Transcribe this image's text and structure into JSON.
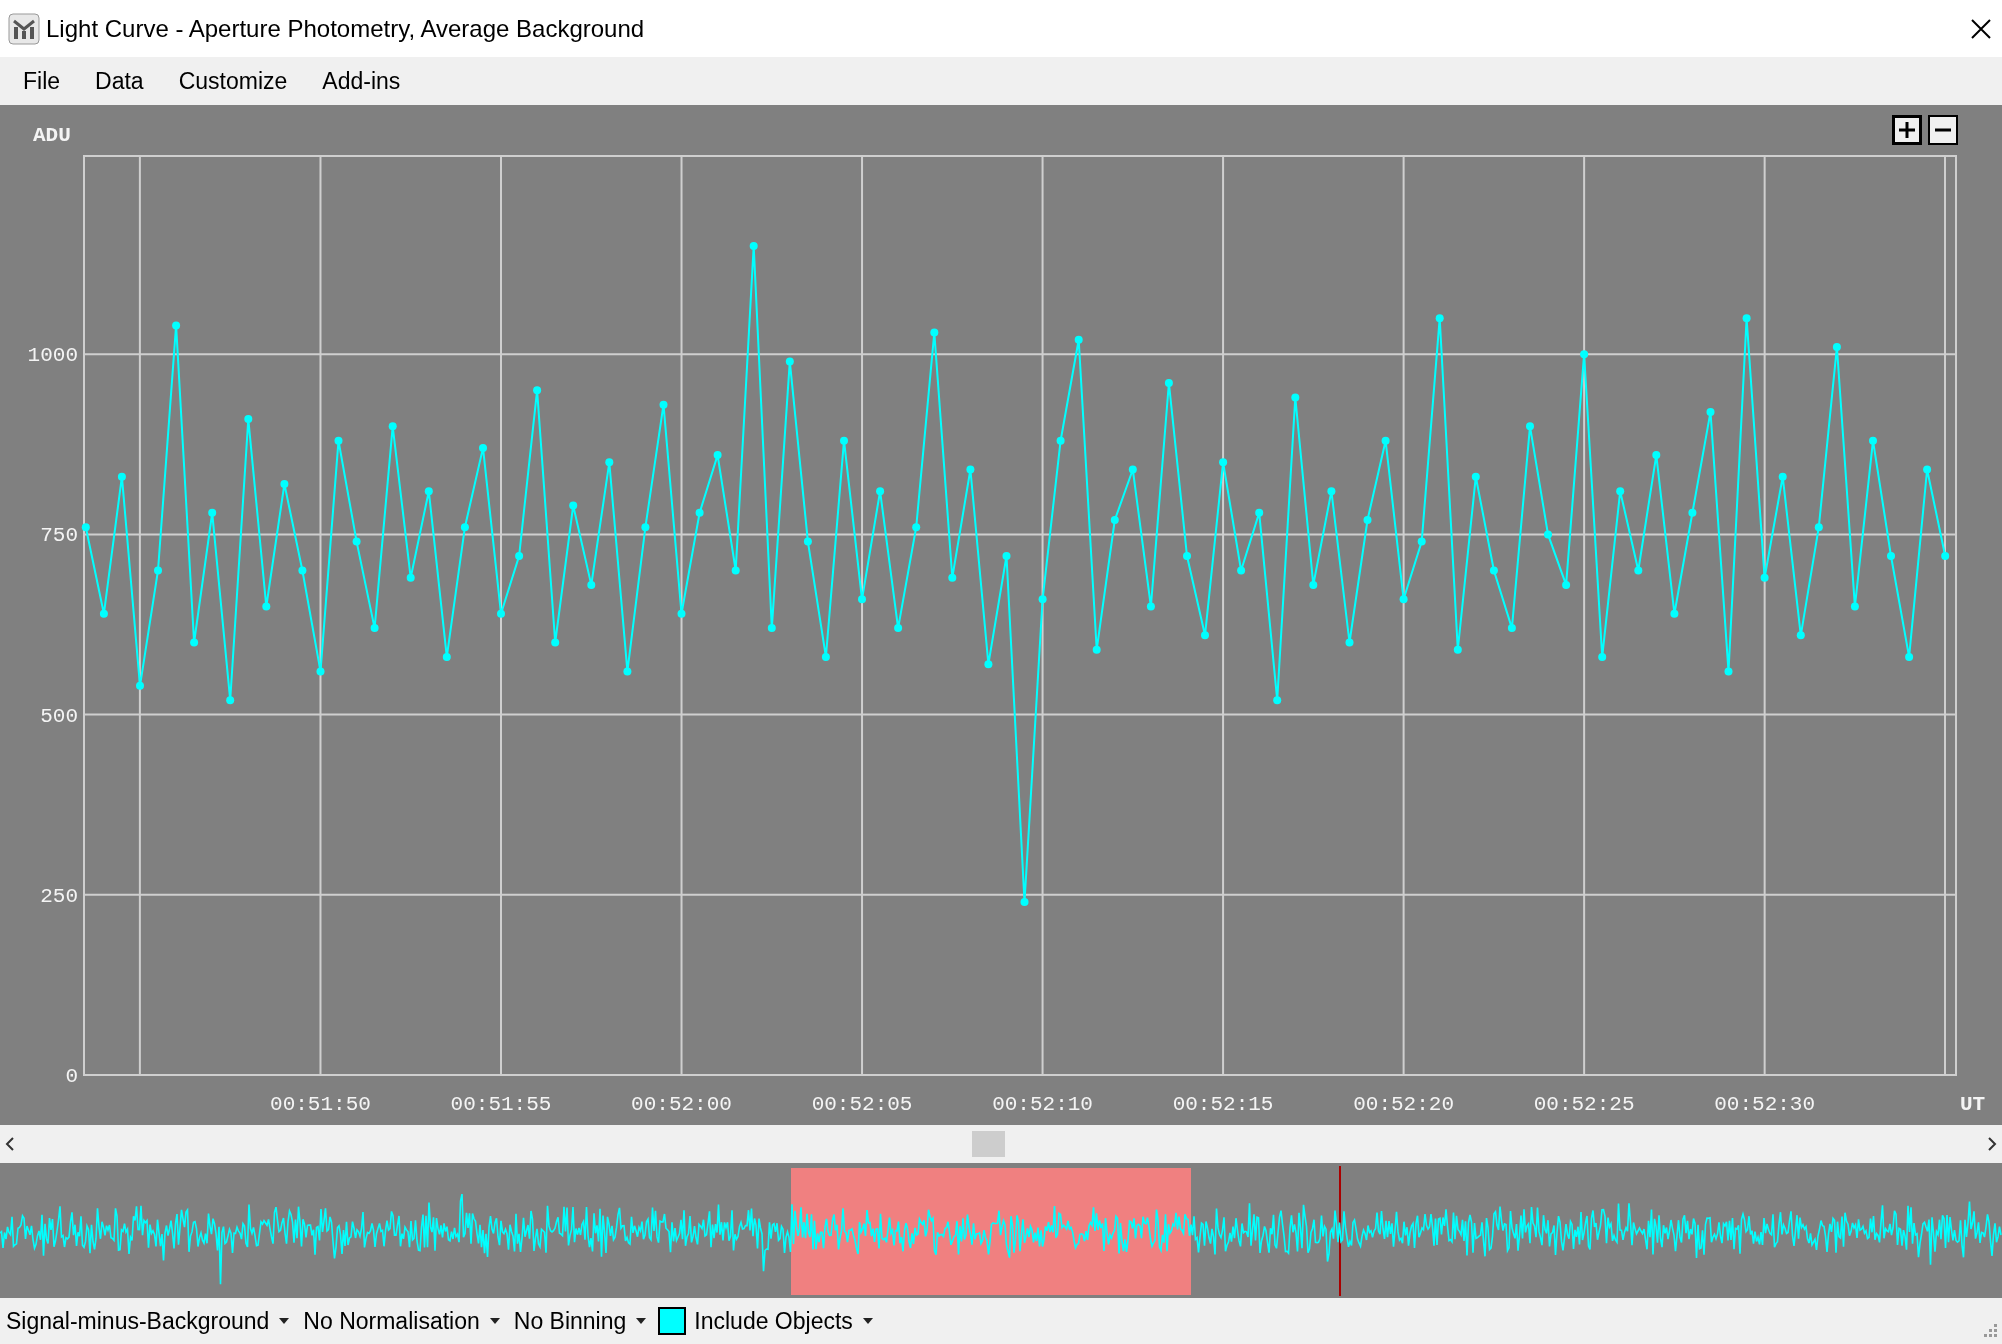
{
  "window": {
    "title": "Light Curve - Aperture Photometry, Average Background"
  },
  "menu": [
    {
      "label": "File"
    },
    {
      "label": "Data"
    },
    {
      "label": "Customize"
    },
    {
      "label": "Add-ins"
    }
  ],
  "plot": {
    "chart_data": {
      "type": "line",
      "grid": true,
      "ylabel": "ADU",
      "xlabel": "UT",
      "xlim": [
        3103.45,
        3155.3
      ],
      "ylim": [
        0,
        1275
      ],
      "xticks": [
        {
          "value": 3110,
          "label": "00:51:50"
        },
        {
          "value": 3115,
          "label": "00:51:55"
        },
        {
          "value": 3120,
          "label": "00:52:00"
        },
        {
          "value": 3125,
          "label": "00:52:05"
        },
        {
          "value": 3130,
          "label": "00:52:10"
        },
        {
          "value": 3135,
          "label": "00:52:15"
        },
        {
          "value": 3140,
          "label": "00:52:20"
        },
        {
          "value": 3145,
          "label": "00:52:25"
        },
        {
          "value": 3150,
          "label": "00:52:30"
        }
      ],
      "yticks": [
        0,
        250,
        500,
        750,
        1000
      ],
      "x": [
        3103.5,
        3104,
        3104.5,
        3105,
        3105.5,
        3106,
        3106.5,
        3107,
        3107.5,
        3108,
        3108.5,
        3109,
        3109.5,
        3110,
        3110.5,
        3111,
        3111.5,
        3112,
        3112.5,
        3113,
        3113.5,
        3114,
        3114.5,
        3115,
        3115.5,
        3116,
        3116.5,
        3117,
        3117.5,
        3118,
        3118.5,
        3119,
        3119.5,
        3120,
        3120.5,
        3121,
        3121.5,
        3122,
        3122.5,
        3123,
        3123.5,
        3124,
        3124.5,
        3125,
        3125.5,
        3126,
        3126.5,
        3127,
        3127.5,
        3128,
        3128.5,
        3129,
        3129.5,
        3130,
        3130.5,
        3131,
        3131.5,
        3132,
        3132.5,
        3133,
        3133.5,
        3134,
        3134.5,
        3135,
        3135.5,
        3136,
        3136.5,
        3137,
        3137.5,
        3138,
        3138.5,
        3139,
        3139.5,
        3140,
        3140.5,
        3141,
        3141.5,
        3142,
        3142.5,
        3143,
        3143.5,
        3144,
        3144.5,
        3145,
        3145.5,
        3146,
        3146.5,
        3147,
        3147.5,
        3148,
        3148.5,
        3149,
        3149.5,
        3150,
        3150.5,
        3151,
        3151.5,
        3152,
        3152.5,
        3153,
        3153.5,
        3154,
        3154.5,
        3155
      ],
      "series": [
        {
          "color": "#00ffff",
          "marker": "circle",
          "values": [
            760,
            640,
            830,
            540,
            700,
            1040,
            600,
            780,
            520,
            910,
            650,
            820,
            700,
            560,
            880,
            740,
            620,
            900,
            690,
            810,
            580,
            760,
            870,
            640,
            720,
            950,
            600,
            790,
            680,
            850,
            560,
            760,
            930,
            640,
            780,
            860,
            700,
            1150,
            620,
            990,
            740,
            580,
            880,
            660,
            810,
            620,
            760,
            1030,
            690,
            840,
            570,
            720,
            240,
            660,
            880,
            1020,
            590,
            770,
            840,
            650,
            960,
            720,
            610,
            850,
            700,
            780,
            520,
            940,
            680,
            810,
            600,
            770,
            880,
            660,
            740,
            1050,
            590,
            830,
            700,
            620,
            900,
            750,
            680,
            1000,
            580,
            810,
            700,
            860,
            640,
            780,
            920,
            560,
            1050,
            690,
            830,
            610,
            760,
            1010,
            650,
            880,
            720,
            580,
            840,
            720
          ]
        }
      ]
    }
  },
  "status_bar": {
    "dropdowns": [
      {
        "label": "Signal-minus-Background",
        "kind": "text"
      },
      {
        "label": "No Normalisation",
        "kind": "text"
      },
      {
        "label": "No Binning",
        "kind": "text"
      },
      {
        "label": "Include Objects",
        "kind": "swatch"
      }
    ]
  }
}
